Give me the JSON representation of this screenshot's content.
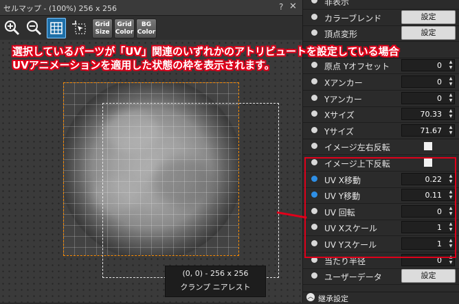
{
  "window": {
    "title": "セルマップ - (100%)  256 x 256",
    "help": "?",
    "close": "✕"
  },
  "toolbar": {
    "zoom_in_icon": "zoom-in-icon",
    "zoom_out_icon": "zoom-out-icon",
    "grid_icon": "grid-icon",
    "cell_select_icon": "cell-select-icon",
    "grid_size": [
      "Grid",
      "Size"
    ],
    "grid_color": [
      "Grid",
      "Color"
    ],
    "bg_color": [
      "BG",
      "Color"
    ]
  },
  "annotation": {
    "line1": "選択しているパーツが「UV」関連のいずれかのアトリビュートを設定している場合",
    "line2": "UVアニメーションを適用した状態の枠を表示されます。"
  },
  "cell_info": {
    "size": "(0, 0) - 256 x 256",
    "mode": "クランプ  ニアレスト"
  },
  "properties": [
    {
      "label": "非表示",
      "kind": "none",
      "value": ""
    },
    {
      "label": "カラーブレンド",
      "kind": "button",
      "value": "設定"
    },
    {
      "label": "頂点変形",
      "kind": "button",
      "value": "設定"
    },
    {
      "label": "",
      "kind": "none",
      "value": ""
    },
    {
      "label": "原点 Yオフセット",
      "kind": "number",
      "value": "0"
    },
    {
      "label": "Xアンカー",
      "kind": "number",
      "value": "0"
    },
    {
      "label": "Yアンカー",
      "kind": "number",
      "value": "0"
    },
    {
      "label": "Xサイズ",
      "kind": "number",
      "value": "70.33"
    },
    {
      "label": "Yサイズ",
      "kind": "number",
      "value": "71.67"
    },
    {
      "label": "イメージ左右反転",
      "kind": "check",
      "value": ""
    },
    {
      "label": "イメージ上下反転",
      "kind": "check",
      "value": ""
    },
    {
      "label": "UV X移動",
      "kind": "number",
      "value": "0.22",
      "active": true
    },
    {
      "label": "UV Y移動",
      "kind": "number",
      "value": "0.11",
      "active": true
    },
    {
      "label": "UV 回転",
      "kind": "number",
      "value": "0"
    },
    {
      "label": "UV Xスケール",
      "kind": "number",
      "value": "1"
    },
    {
      "label": "UV Yスケール",
      "kind": "number",
      "value": "1"
    },
    {
      "label": "当たり半径",
      "kind": "number",
      "value": "0"
    },
    {
      "label": "ユーザーデータ",
      "kind": "button",
      "value": "設定"
    }
  ],
  "inherit": {
    "label": "継承設定",
    "icon": "chevron-up-icon"
  },
  "colors": {
    "accent_red": "#e0001a",
    "frame_orange": "#ff8c00",
    "active_dot": "#2e8fe6"
  }
}
